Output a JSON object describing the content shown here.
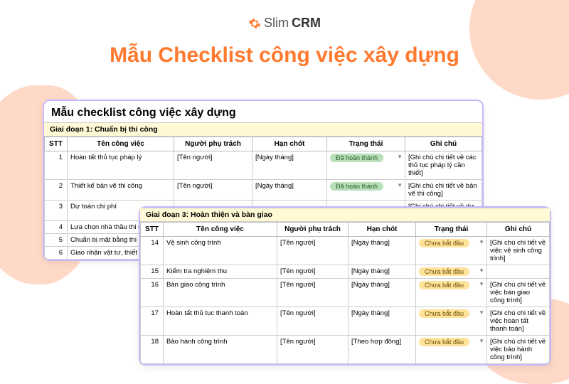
{
  "brand": {
    "slim": "Slim",
    "crm": "CRM"
  },
  "main_title": "Mẫu Checklist công việc xây dựng",
  "card1": {
    "title": "Mẫu checklist công việc xây dựng",
    "section": "Giai đoạn 1: Chuẩn bị thi công",
    "headers": {
      "stt": "STT",
      "name": "Tên công việc",
      "person": "Người phụ trách",
      "deadline": "Hạn chót",
      "status": "Trạng thái",
      "note": "Ghi chú"
    },
    "rows": [
      {
        "stt": "1",
        "name": "Hoàn tất thủ tục pháp lý",
        "person": "[Tên người]",
        "deadline": "[Ngày tháng]",
        "status": "Đã hoàn thành",
        "status_type": "done",
        "note": "[Ghi chú chi tiết về các thủ tục pháp lý cần thiết]"
      },
      {
        "stt": "2",
        "name": "Thiết kế bản vẽ thi công",
        "person": "[Tên người]",
        "deadline": "[Ngày tháng]",
        "status": "Đã hoàn thành",
        "status_type": "done",
        "note": "[Ghi chú chi tiết về bản vẽ thi công]"
      },
      {
        "stt": "3",
        "name": "Dự toán chi phí",
        "person": "",
        "deadline": "",
        "status": "",
        "status_type": "",
        "note": "[Ghi chú chi tiết về dự toán]"
      },
      {
        "stt": "4",
        "name": "Lựa chọn nhà thầu thi công",
        "person": "",
        "deadline": "",
        "status": "",
        "status_type": "",
        "note": ""
      },
      {
        "stt": "5",
        "name": "Chuẩn bị mặt bằng thi công",
        "person": "",
        "deadline": "",
        "status": "",
        "status_type": "",
        "note": ""
      },
      {
        "stt": "6",
        "name": "Giao nhận vật tư, thiết bị",
        "person": "",
        "deadline": "",
        "status": "",
        "status_type": "",
        "note": ""
      }
    ]
  },
  "card2": {
    "section": "Giai đoạn 3: Hoàn thiện và bàn giao",
    "headers": {
      "stt": "STT",
      "name": "Tên công việc",
      "person": "Người phụ trách",
      "deadline": "Hạn chót",
      "status": "Trạng thái",
      "note": "Ghi chú"
    },
    "rows": [
      {
        "stt": "14",
        "name": "Vệ sinh công trình",
        "person": "[Tên người]",
        "deadline": "[Ngày tháng]",
        "status": "Chưa bắt đầu",
        "status_type": "notstart",
        "note": "[Ghi chú chi tiết về việc vệ sinh công trình]"
      },
      {
        "stt": "15",
        "name": "Kiểm tra nghiệm thu",
        "person": "[Tên người]",
        "deadline": "[Ngày tháng]",
        "status": "Chưa bắt đầu",
        "status_type": "notstart",
        "note": ""
      },
      {
        "stt": "16",
        "name": "Bàn giao công trình",
        "person": "[Tên người]",
        "deadline": "[Ngày tháng]",
        "status": "Chưa bắt đầu",
        "status_type": "notstart",
        "note": "[Ghi chú chi tiết về việc bàn giao công trình]"
      },
      {
        "stt": "17",
        "name": "Hoàn tất thủ tục thanh toán",
        "person": "[Tên người]",
        "deadline": "[Ngày tháng]",
        "status": "Chưa bắt đầu",
        "status_type": "notstart",
        "note": "[Ghi chú chi tiết về việc hoàn tất thanh toán]"
      },
      {
        "stt": "18",
        "name": "Bảo hành công trình",
        "person": "[Tên người]",
        "deadline": "[Theo hợp đồng]",
        "status": "Chưa bắt đầu",
        "status_type": "notstart",
        "note": "[Ghi chú chi tiết về việc bảo hành công trình]"
      }
    ]
  }
}
